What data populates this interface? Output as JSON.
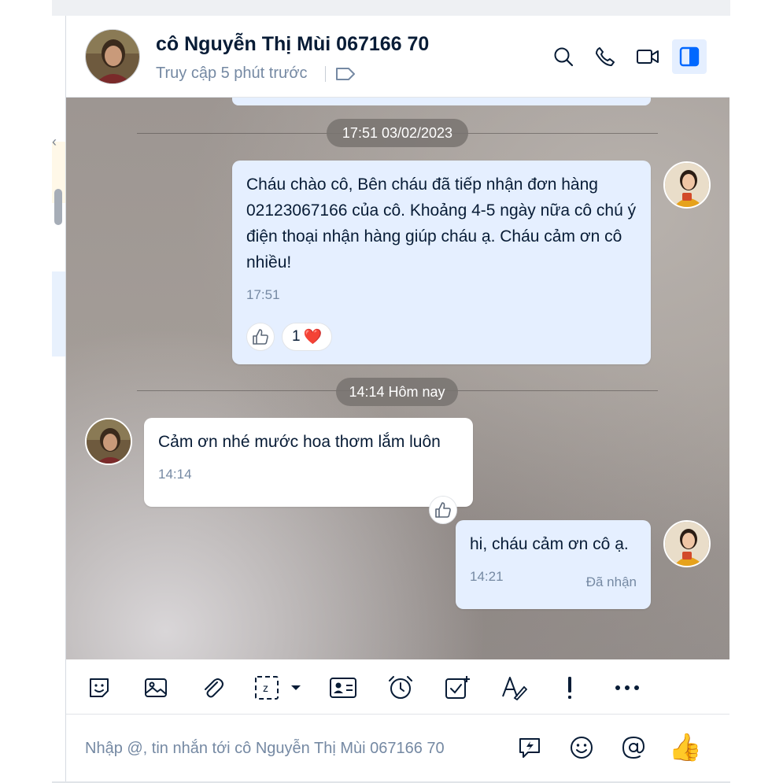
{
  "header": {
    "contact_name": "cô Nguyễn Thị Mùi 067166 70",
    "status": "Truy cập 5 phút trước"
  },
  "messages": {
    "divider1": "17:51 03/02/2023",
    "msg1": {
      "text": "Cháu chào cô, Bên cháu đã tiếp nhận đơn hàng 02123067166 của cô. Khoảng 4-5 ngày nữa cô chú ý điện thoại nhận hàng giúp cháu ạ. Cháu cảm ơn cô nhiều!",
      "time": "17:51",
      "reaction_count": "1",
      "reaction_emoji": "❤️"
    },
    "divider2": "14:14 Hôm nay",
    "msg2": {
      "text": "Cảm ơn nhé mước hoa thơm lắm luôn",
      "time": "14:14"
    },
    "msg3": {
      "text": "hi, cháu cảm ơn cô ạ.",
      "time": "14:21",
      "status": "Đã nhận"
    }
  },
  "toolbar": {
    "icons": [
      "sticker-icon",
      "image-icon",
      "attachment-icon",
      "screenshot-icon",
      "contact-card-icon",
      "reminder-icon",
      "task-icon",
      "format-text-icon",
      "important-icon",
      "more-icon"
    ]
  },
  "composer": {
    "placeholder": "Nhập @, tin nhắn tới cô Nguyễn Thị Mùi 067166 70",
    "send_emoji": "👍"
  },
  "colors": {
    "accent": "#0068ff",
    "my_bubble": "#e5efff",
    "their_bubble": "#ffffff",
    "text_primary": "#081c36",
    "text_secondary": "#7589a3"
  }
}
